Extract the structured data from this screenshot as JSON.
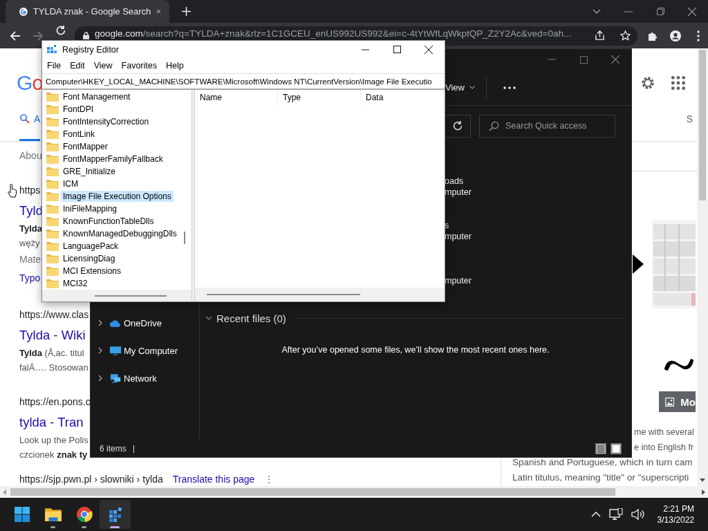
{
  "browser": {
    "tabs": [
      {
        "title": "TYLDA znak - Google Search",
        "selected": true
      }
    ],
    "url_host": "google.com",
    "url_path": "/search?q=TYLDA+znak&rlz=1C1GCEU_enUS992US992&ei=c-4tYtWfLqWkptQP_Z2Y2Ac&ved=0ah..."
  },
  "google": {
    "logo": "Go",
    "tabs": [
      {
        "label": "A",
        "selected": true
      },
      {
        "label": "S",
        "selected": false
      }
    ],
    "about": "Abou",
    "results": [
      {
        "url": "https",
        "title": "Tyld",
        "snippet": [
          "**Tylda**",
          "węży"
        ],
        "extra": [
          {
            "kind": "meta",
            "text": "Mate"
          },
          {
            "kind": "link",
            "text": "Typo"
          }
        ]
      },
      {
        "url": "https://www.clas",
        "title": "Tylda - Wiki",
        "snippet": [
          "**Tylda** (Å‚ac. titul",
          "falÄ…. Stosowan"
        ]
      },
      {
        "url": "https://en.pons.c",
        "title": "tylda - Tran",
        "snippet": [
          "Look up the Polis",
          "czcionek **znak ty**"
        ]
      }
    ],
    "footer": {
      "url": "https://sjp.pwn.pl › slowniki › tylda",
      "translate": "Translate this page",
      "menu": "⋮"
    },
    "more_images": "Mo",
    "side_text_partial": [
      "me with several",
      "e into English fr"
    ],
    "side_text": [
      "Spanish and Portuguese, which in turn cam",
      "Latin titulus, meaning \"title\" or \"superscripti"
    ]
  },
  "explorer": {
    "view": "View",
    "search_placeholder": "Search Quick access",
    "pinned": [
      {
        "name": "oads",
        "location": "mputer"
      },
      {
        "name": "s",
        "location": "mputer"
      },
      {
        "location": "mputer"
      }
    ],
    "nav": [
      {
        "kind": "cloud",
        "label": "OneDrive",
        "expanded": false
      },
      {
        "kind": "computer",
        "label": "My Computer",
        "expanded": false
      },
      {
        "kind": "network",
        "label": "Network",
        "expanded": false
      }
    ],
    "recent": {
      "title": "Recent files (0)",
      "expanded": true,
      "empty_message": "After you’ve opened some files, we’ll show the most recent ones here."
    },
    "status": "6 items"
  },
  "regedit": {
    "title": "Registry Editor",
    "menu": [
      "File",
      "Edit",
      "View",
      "Favorites",
      "Help"
    ],
    "path": "Computer\\HKEY_LOCAL_MACHINE\\SOFTWARE\\Microsoft\\Windows NT\\CurrentVersion\\Image File Executio",
    "tree": [
      {
        "label": "Font Management",
        "selected": false
      },
      {
        "label": "FontDPI",
        "selected": false
      },
      {
        "label": "FontIntensityCorrection",
        "selected": false
      },
      {
        "label": "FontLink",
        "selected": false
      },
      {
        "label": "FontMapper",
        "selected": false
      },
      {
        "label": "FontMapperFamilyFallback",
        "selected": false
      },
      {
        "label": "GRE_Initialize",
        "selected": false
      },
      {
        "label": "ICM",
        "selected": false
      },
      {
        "label": "Image File Execution Options",
        "selected": true
      },
      {
        "label": "IniFileMapping",
        "selected": false
      },
      {
        "label": "KnownFunctionTableDlls",
        "selected": false
      },
      {
        "label": "KnownManagedDebuggingDlls",
        "selected": false
      },
      {
        "label": "LanguagePack",
        "selected": false
      },
      {
        "label": "LicensingDiag",
        "selected": false
      },
      {
        "label": "MCI Extensions",
        "selected": false
      },
      {
        "label": "MCI32",
        "selected": false
      }
    ],
    "columns": [
      "Name",
      "Type",
      "Data"
    ]
  },
  "taskbar": {
    "apps": [
      {
        "kind": "start",
        "running": false,
        "selected": false
      },
      {
        "kind": "folder",
        "running": true,
        "selected": false
      },
      {
        "kind": "browser",
        "running": true,
        "selected": false
      },
      {
        "kind": "registry",
        "running": true,
        "selected": true
      }
    ],
    "time": "2:21 PM",
    "date": "3/13/2022"
  }
}
